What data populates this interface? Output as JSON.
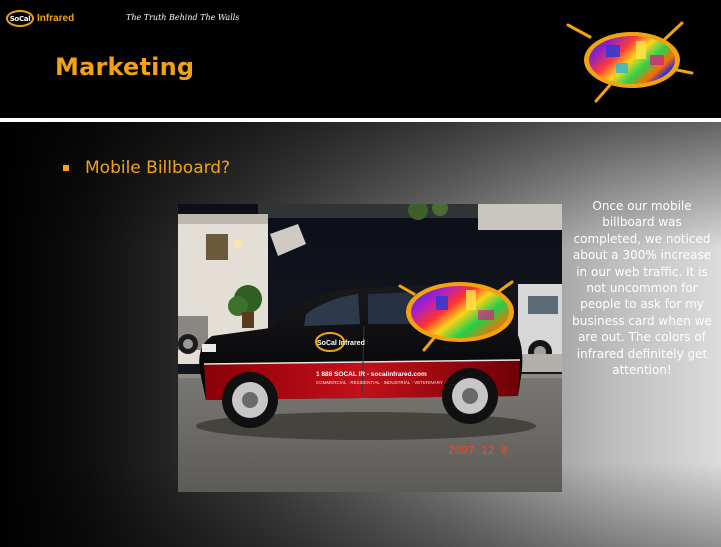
{
  "header": {
    "brand_badge": "SoCal",
    "brand_name": "Infrared",
    "tagline": "The Truth Behind The Walls",
    "title": "Marketing"
  },
  "content": {
    "bullet": "Mobile Billboard?",
    "description": "Once our mobile billboard was completed, we noticed about a 300% increase in our web traffic.  It is not uncommon for people to ask for my business card when we are out.  The colors of infrared definitely get attention!",
    "photo": {
      "vehicle_logo": "SoCal Infrared",
      "vehicle_phone": "1 888 SOCAL IR - socalinfrared.com",
      "vehicle_services": "COMMERCIAL · RESIDENTIAL · INDUSTRIAL · VETERINARY",
      "date_stamp": "2007  12  8"
    }
  },
  "colors": {
    "accent_orange": "#f2a30f",
    "header_background": "#000000",
    "rule": "#ffffff"
  },
  "icons": {
    "header_logo": "thermal-eye-logo-icon",
    "bullet": "square-bullet-icon"
  }
}
